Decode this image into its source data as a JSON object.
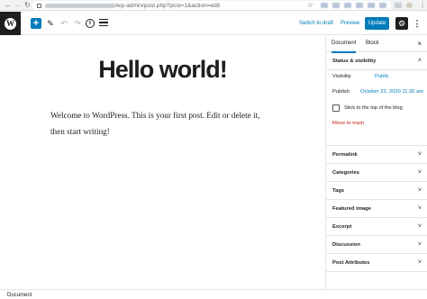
{
  "browser": {
    "url": "/wp-admin/post.php?post=1&action=edit"
  },
  "toolbar": {
    "add_label": "+",
    "switch_to_draft": "Switch to draft",
    "preview": "Preview",
    "update": "Update"
  },
  "post": {
    "title": "Hello world!",
    "body": "Welcome to WordPress. This is your first post. Edit or delete it, then start writing!"
  },
  "sidebar": {
    "tabs": [
      "Document",
      "Block"
    ],
    "status_panel": {
      "title": "Status & visibility",
      "visibility_label": "Visibility",
      "visibility_value": "Public",
      "publish_label": "Publish",
      "publish_value": "October 22, 2020 11:35 am",
      "stick_label": "Stick to the top of the blog",
      "trash_label": "Move to trash"
    },
    "panels": [
      "Permalink",
      "Categories",
      "Tags",
      "Featured image",
      "Excerpt",
      "Discussion",
      "Post Attributes"
    ]
  },
  "footer": {
    "breadcrumb": "Document"
  },
  "icons": {
    "wp_logo": "W",
    "edit": "✎",
    "undo": "↶",
    "redo": "↷",
    "info": "i",
    "settings": "⚙",
    "more": "⋮",
    "close": "×",
    "chevron_up": "˄",
    "chevron_down": "˅"
  },
  "colors": {
    "accent": "#007cba",
    "danger": "#cc1818",
    "dark": "#1e1e1e"
  }
}
